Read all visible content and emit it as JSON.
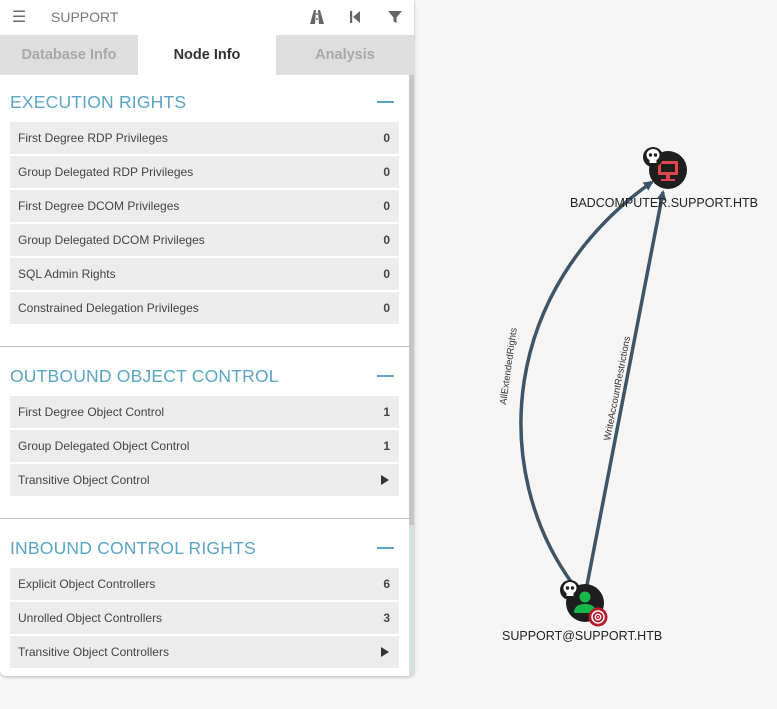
{
  "search": {
    "text": "SUPPORT"
  },
  "tabs": [
    {
      "label": "Database Info"
    },
    {
      "label": "Node Info"
    },
    {
      "label": "Analysis"
    }
  ],
  "sections": [
    {
      "title": "EXECUTION RIGHTS",
      "rows": [
        {
          "label": "First Degree RDP Privileges",
          "value": "0"
        },
        {
          "label": "Group Delegated RDP Privileges",
          "value": "0"
        },
        {
          "label": "First Degree DCOM Privileges",
          "value": "0"
        },
        {
          "label": "Group Delegated DCOM Privileges",
          "value": "0"
        },
        {
          "label": "SQL Admin Rights",
          "value": "0"
        },
        {
          "label": "Constrained Delegation Privileges",
          "value": "0"
        }
      ]
    },
    {
      "title": "OUTBOUND OBJECT CONTROL",
      "rows": [
        {
          "label": "First Degree Object Control",
          "value": "1"
        },
        {
          "label": "Group Delegated Object Control",
          "value": "1"
        },
        {
          "label": "Transitive Object Control",
          "value": ""
        }
      ]
    },
    {
      "title": "INBOUND CONTROL RIGHTS",
      "rows": [
        {
          "label": "Explicit Object Controllers",
          "value": "6"
        },
        {
          "label": "Unrolled Object Controllers",
          "value": "3"
        },
        {
          "label": "Transitive Object Controllers",
          "value": ""
        }
      ]
    }
  ],
  "graph": {
    "nodes": {
      "computer": {
        "label": "BADCOMPUTER.SUPPORT.HTB"
      },
      "user": {
        "label": "SUPPORT@SUPPORT.HTB"
      }
    },
    "edges": {
      "all_extended_rights": {
        "label": "AllExtendedRights"
      },
      "write_account_restrictions": {
        "label": "WriteAccountRestrictions"
      }
    }
  },
  "colors": {
    "accent": "#5aa5c4",
    "edge": "#3d5566",
    "computer_icon": "#e0474c",
    "user_icon": "#17b84b",
    "target_badge": "#b8182c"
  }
}
